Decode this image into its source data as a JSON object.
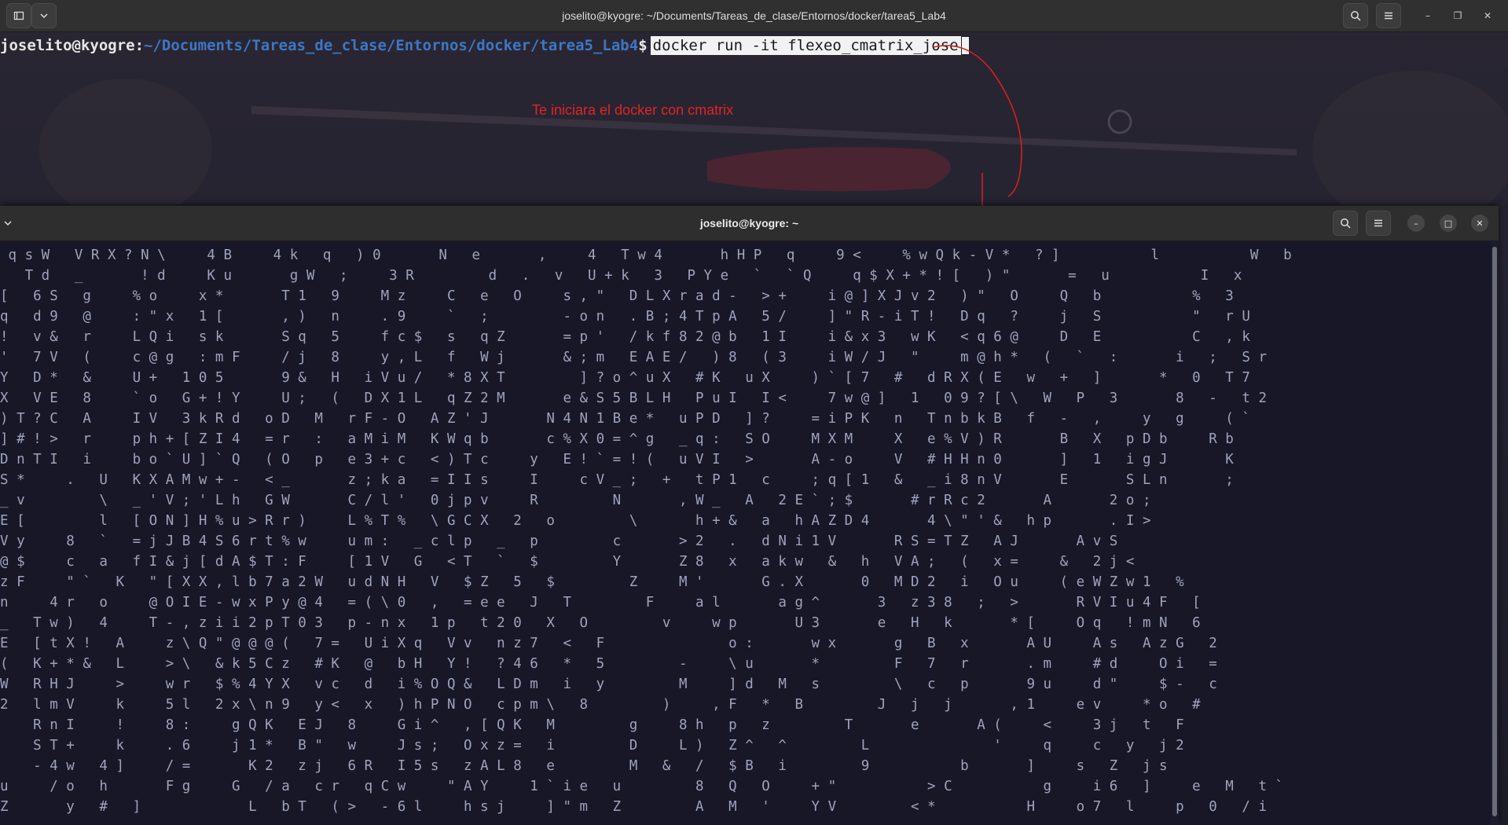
{
  "back_window": {
    "title": "joselito@kyogre: ~/Documents/Tareas_de_clase/Entornos/docker/tarea5_Lab4",
    "buttons": {
      "new_tab_icon": "new-tab-icon",
      "dropdown_icon": "chevron-down-icon",
      "search_icon": "search-icon",
      "menu_icon": "hamburger-menu-icon",
      "minimize": "–",
      "maximize": "❐",
      "close": "✕"
    },
    "prompt_user": "joselito@kyogre",
    "prompt_colon": ":",
    "prompt_path": "~/Documents/Tareas_de_clase/Entornos/docker/tarea5_Lab4",
    "prompt_dollar": "$",
    "command": "docker run -it flexeo_cmatrix_jose",
    "annotation": "Te iniciara el docker con cmatrix",
    "annotation_color": "#e02525"
  },
  "front_window": {
    "title": "joselito@kyogre: ~",
    "buttons": {
      "dropdown_icon": "chevron-down-icon",
      "search_icon": "search-icon",
      "menu_icon": "hamburger-menu-icon",
      "minimize": "–",
      "maximize": "□",
      "close": "✕"
    },
    "matrix_rows": [
      " q s W   V R X ? N \\     4 B     4 k   q   ) 0       N   e       ,     4   T w 4       h H P   q     9 <     % w Q k - V *   ? ]           l           W   b",
      "   T d   _       ! d     K u       g W   ;     3 R         d   .   v   U + k   3   P Y e   `   ` Q     q $ X + * ! [   ) \"       =   u           I   x",
      "[   6 S   g     % o     x *       T 1   9     M z     C   e   O     s , \"   D L X r a d -   > +     i @ ] X J v 2   ) \"   O     Q   b           %   3",
      "q   d 9   @     : \" x   1 [       , )   n     . 9     `   ;         - o n   . B ; 4 T p A   5 /     ] \" R - i T !   D q   ?     j   S           \"   r U",
      "!   v &   r     L Q i   s k       S q   5     f c $   s   q Z       = p '   / k f 8 2 @ b   1 I     i & x 3   w K   < q 6 @     D   E           C   , k",
      "'   7 V   (     c @ g   : m F     / j   8     y , L   f   W j       & ; m   E A E /   ) 8   ( 3     i W / J   \"     m @ h *   (   `   :       i   ;   S r",
      "Y   D *   &     U +   1 0 5       9 &   H   i V u /   * 8 X T         ] ? o ^ u X   # K   u X     ) ` [ 7   #   d R X ( E   w   +   ]       *   0   T 7",
      "X   V E   8     ` o   G + ! Y     U ;   (   D X 1 L   q Z 2 M       e & S 5 B L H   P u I   I <     7 w @ ]   1   0 9 ? [ \\   W   P   3       8   -   t 2",
      ") T ? C   A     I V   3 k R d   o D   M   r F - O   A Z ' J       N 4 N 1 B e *   u P D   ] ?     = i P K   n   T n b k B   f   -   ,     y   g     ( `",
      "] # ! >   r     p h + [ Z I 4   = r   :   a M i M   K W q b       c % X 0 = ^ g   _ q :   S O     M X M     X   e % V ) R       B   X   p D b     R b",
      "D n T I   i     b o ` U ] ` Q   ( O   p   e 3 + c   < ) T c     y   E ! ` = ! (   u V I   >       A - o     V   # H H n 0       ]   1   i g J       K",
      "S *     .   U   K X A M w + -   < _       z ; k a   = I I s     I     c V _ ;   +   t P 1   c     ; q [ 1   &   _ i 8 n V       E       S L n       ;",
      "_ v         \\   _ ' V ; ' L h   G W       C / l '   0 j p v     R         N       , W _   A   2 E ` ; $       # r R c 2       A       2 o ;",
      "E [         l   [ O N ] H % u > R r )     L % T %   \\ G C X   2   o         \\       h + &   a   h A Z D 4       4 \\ \" ' &   h p       . I >",
      "V y     8   `   = j J B 4 S 6 r t % w     u m :   _ c l p   _   p         c       > 2   .   d N i 1 V       R S = T Z   A J       A v S",
      "@ $     c   a   f I & j [ d A $ T : F     [ 1 V   G   < T   `   $         Y       Z 8   x   a k w   &   h   V A ;   (   x =     &   2 j <",
      "z F     \" `   K   \" [ X X , l b 7 a 2 W   u d N H   V   $ Z   5   $         Z     M '       G . X       0   M D 2   i   O u     ( e W Z w 1   %",
      "n     4 r   o     @ O I E - w x P y @ 4   = ( \\ 0   ,   = e e   J   T         F     a l       a g ^       3   z 3 8   ;   >       R V I u 4 F   [",
      "_   T w )   4     T - , z i i 2 p T 0 3   p - n x   1 p   t 2 0   X   O         v     w p       U 3       e   H   k       * [     O q   ! m N   6",
      "E   [ t X !   A     z \\ Q \" @ @ @ (   7 =   U i X q   V v   n z 7   <   F               o :       w x       g   B   x       A U     A s   A z G   2",
      "(   K + * &   L     > \\   & k 5 C z   # K   @   b H   Y !   ? 4 6   *   5         -     \\ u       *         F   7   r       . m     # d     O i   =",
      "W   R H J     >     w r   $ % 4 Y X   v c   d   i % O Q &   L D m   i   y         M     ] d   M   s         \\   c   p       9 u     d \"     $ -   c",
      "2   l m V     k     5 l   2 x \\ n 9   y <   x   ) h P N O   c p m \\   8         )     , F   *   B         J   j   j       , 1     e v     * o   #",
      "    R n I     !     8 :     g Q K   E J   8     G i ^   , [ Q K   M         g     8 h   p   z         T       e       A (     <     3 j   t   F",
      "    S T +     k     . 6     j 1 *   B \"   w     J s ;   O x z =   i         D     L )   Z ^   ^         L               '     q     c   y   j 2",
      "    - 4 w   4 ]     / =       K 2   z j   6 R   I 5 s   z A L 8   e         M   &   /   $ B   i         9           b       ]     s   Z   j s",
      "u     / o   h       F g     G   / a   c r   q C w     \" A Y     1 ` i e   u         8   Q   O     + \"           > C           g     i 6   ]     e   M   t `",
      "Z       y   #   ]             L   b T   ( >   - 6 l     h s j     ] \" m   Z         A   M   '     Y V         < *           H     o 7   l     p   0   / i"
    ]
  }
}
